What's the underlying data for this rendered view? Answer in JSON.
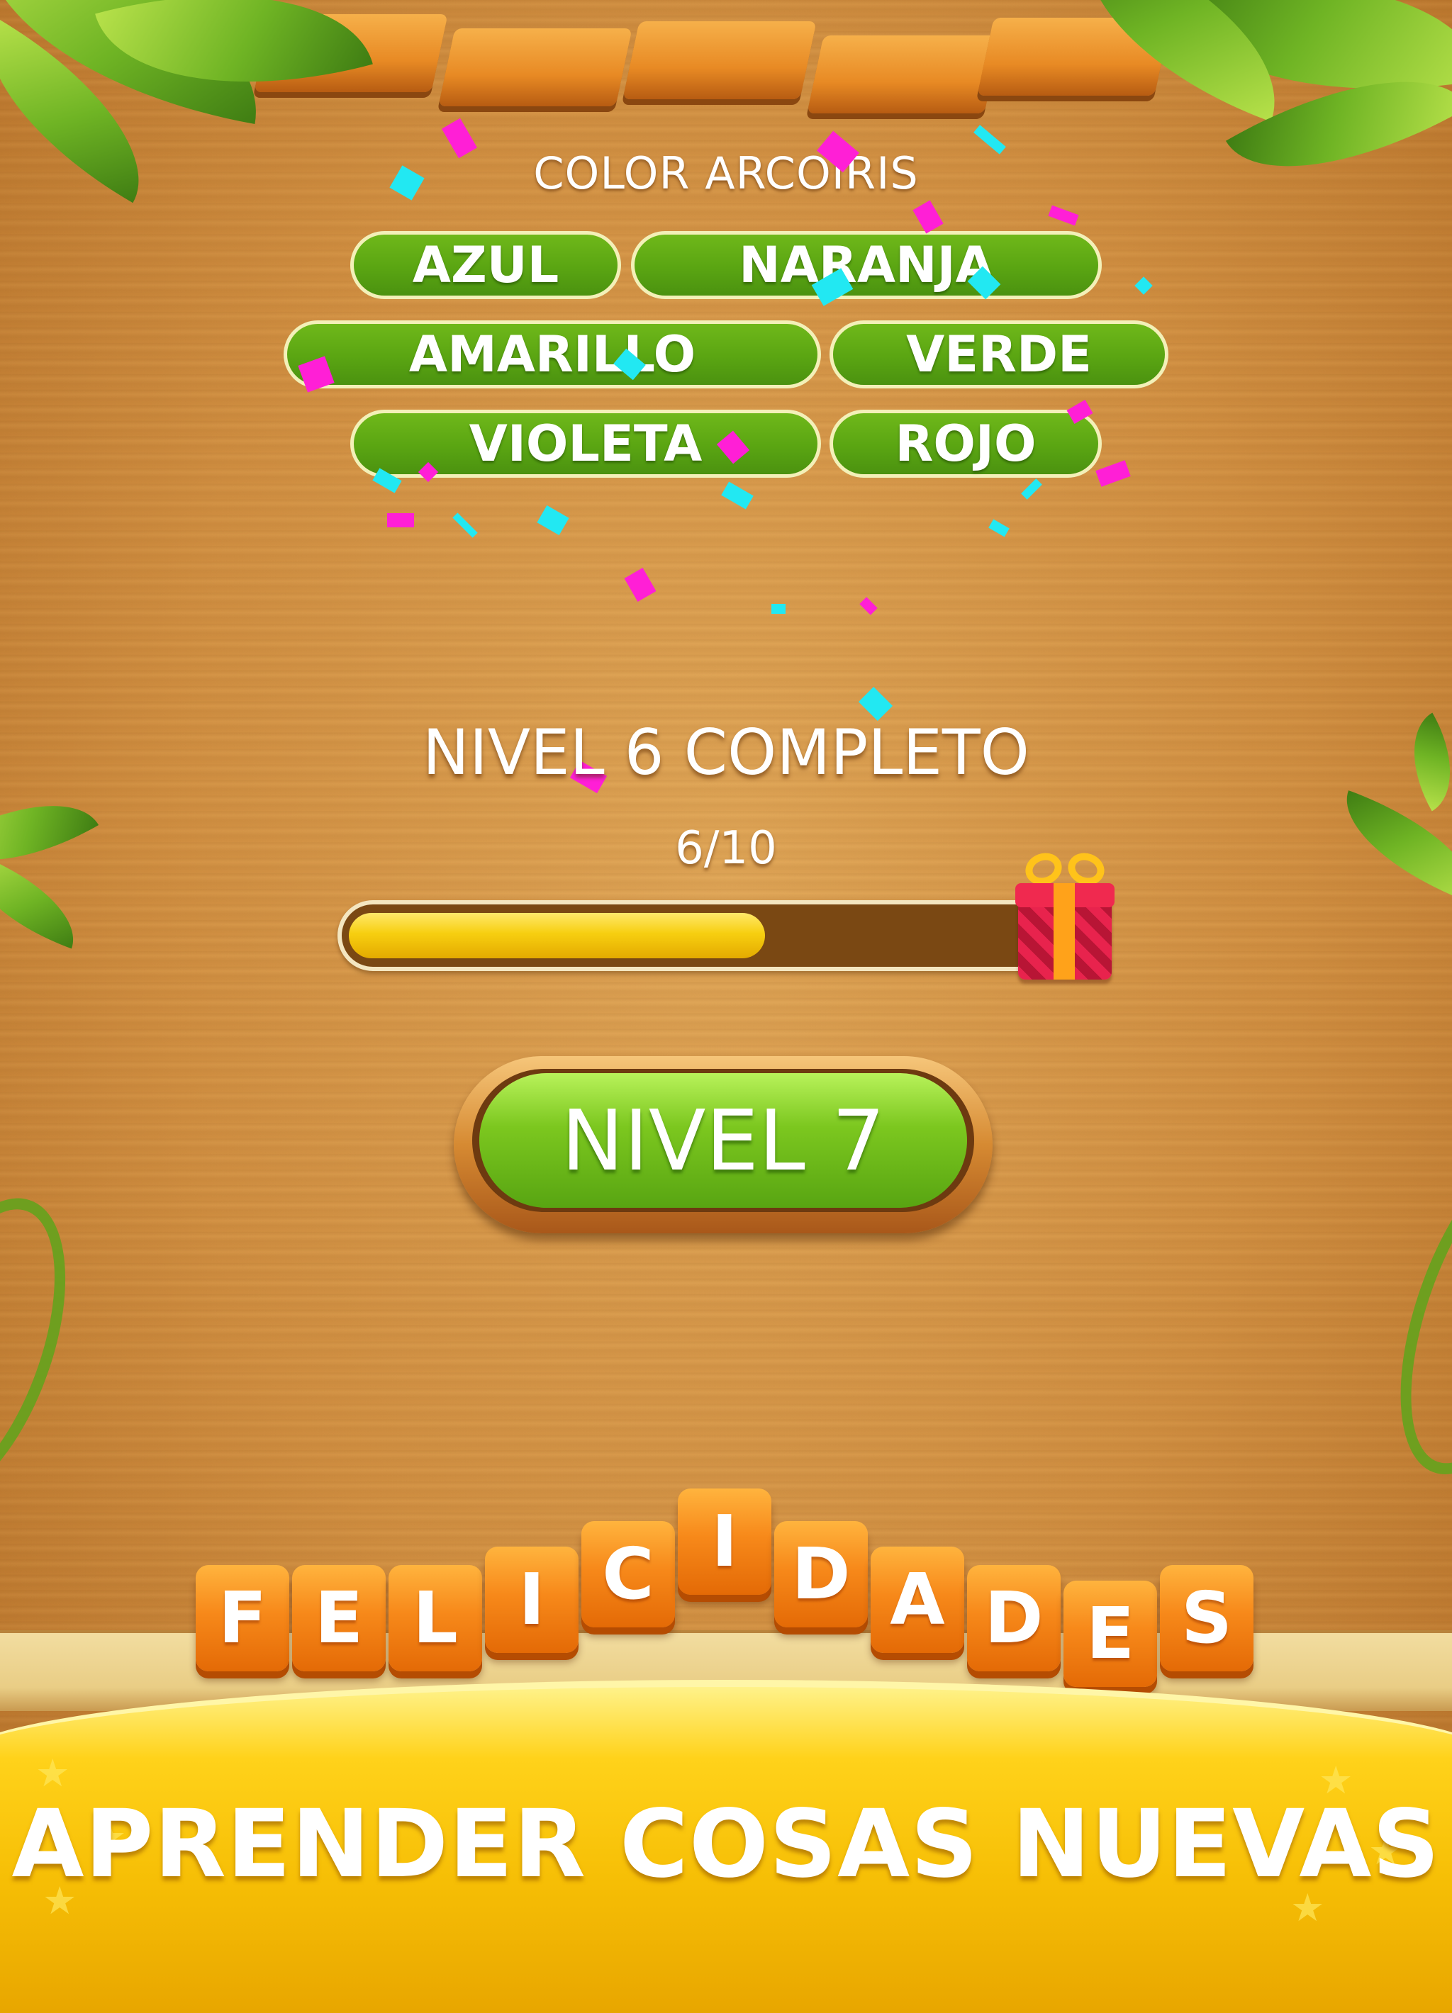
{
  "category": {
    "title": "COLOR ARCOIRIS"
  },
  "words": [
    "AZUL",
    "NARANJA",
    "AMARILLO",
    "VERDE",
    "VIOLETA",
    "ROJO"
  ],
  "level": {
    "complete_text": "NIVEL 6 COMPLETO",
    "progress_text": "6/10",
    "progress": {
      "current": 6,
      "total": 10
    }
  },
  "reward": {
    "icon": "gift-icon"
  },
  "next_button": {
    "label": "NIVEL 7"
  },
  "celebration_tiles": [
    "F",
    "E",
    "L",
    "I",
    "C",
    "I",
    "D",
    "A",
    "D",
    "E",
    "S"
  ],
  "banner": {
    "tagline": "APRENDER COSAS NUEVAS"
  },
  "colors": {
    "chip_green": "#5aa512",
    "progress_yellow": "#f7cf10",
    "tile_orange": "#f7891a",
    "banner_yellow": "#ffd21a",
    "confetti_pink": "#ff1fd6",
    "confetti_cyan": "#22e8f2"
  }
}
